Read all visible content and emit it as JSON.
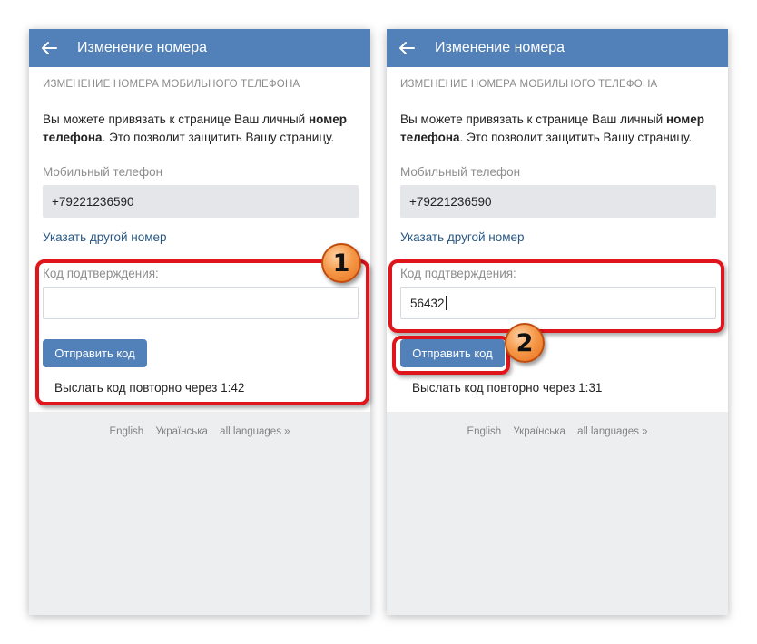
{
  "screens": [
    {
      "header_title": "Изменение номера",
      "section_title": "ИЗМЕНЕНИЕ НОМЕРА МОБИЛЬНОГО ТЕЛЕФОНА",
      "desc_part1": "Вы можете привязать к странице Ваш личный ",
      "desc_bold1": "номер",
      "desc_bold2": "телефона",
      "desc_part2": ". Это позволит защитить Вашу страницу.",
      "phone_label": "Мобильный телефон",
      "phone_value": "+79221236590",
      "change_number_link": "Указать другой номер",
      "code_label": "Код подтверждения:",
      "code_value": "",
      "send_button": "Отправить код",
      "resend_text": "Выслать код повторно через 1:42",
      "languages": [
        "English",
        "Українська",
        "all languages »"
      ],
      "callout_number": "1"
    },
    {
      "header_title": "Изменение номера",
      "section_title": "ИЗМЕНЕНИЕ НОМЕРА МОБИЛЬНОГО ТЕЛЕФОНА",
      "desc_part1": "Вы можете привязать к странице Ваш личный ",
      "desc_bold1": "номер",
      "desc_bold2": "телефона",
      "desc_part2": ". Это позволит защитить Вашу страницу.",
      "phone_label": "Мобильный телефон",
      "phone_value": "+79221236590",
      "change_number_link": "Указать другой номер",
      "code_label": "Код подтверждения:",
      "code_value": "56432",
      "send_button": "Отправить код",
      "resend_text": "Выслать код повторно через 1:31",
      "languages": [
        "English",
        "Українська",
        "all languages »"
      ],
      "callout_number": "2"
    }
  ],
  "colors": {
    "header_bg": "#5181b8",
    "link": "#2a5885",
    "highlight": "#e0141b",
    "badge": "#f59a4a"
  },
  "icons": {
    "back": "arrow-left-icon"
  }
}
